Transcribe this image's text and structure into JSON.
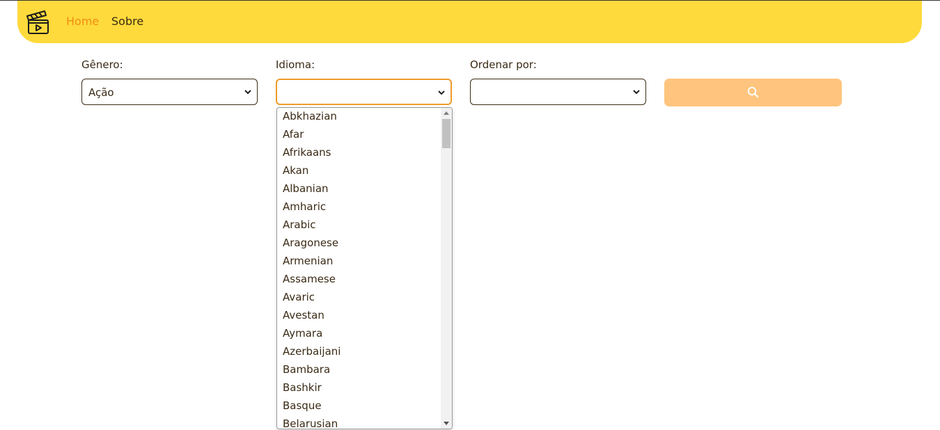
{
  "nav": {
    "home": "Home",
    "about": "Sobre"
  },
  "filters": {
    "genre": {
      "label": "Gênero:",
      "value": "Ação"
    },
    "language": {
      "label": "Idioma:",
      "value": ""
    },
    "order": {
      "label": "Ordenar por:",
      "value": ""
    }
  },
  "language_options": [
    "Abkhazian",
    "Afar",
    "Afrikaans",
    "Akan",
    "Albanian",
    "Amharic",
    "Arabic",
    "Aragonese",
    "Armenian",
    "Assamese",
    "Avaric",
    "Avestan",
    "Aymara",
    "Azerbaijani",
    "Bambara",
    "Bashkir",
    "Basque",
    "Belarusian"
  ],
  "colors": {
    "navbar": "#ffda3c",
    "accent": "#f08c14",
    "search_button": "#ffc57e",
    "text": "#3a2a15"
  },
  "icons": {
    "logo": "clapperboard-icon",
    "search": "search-icon"
  }
}
